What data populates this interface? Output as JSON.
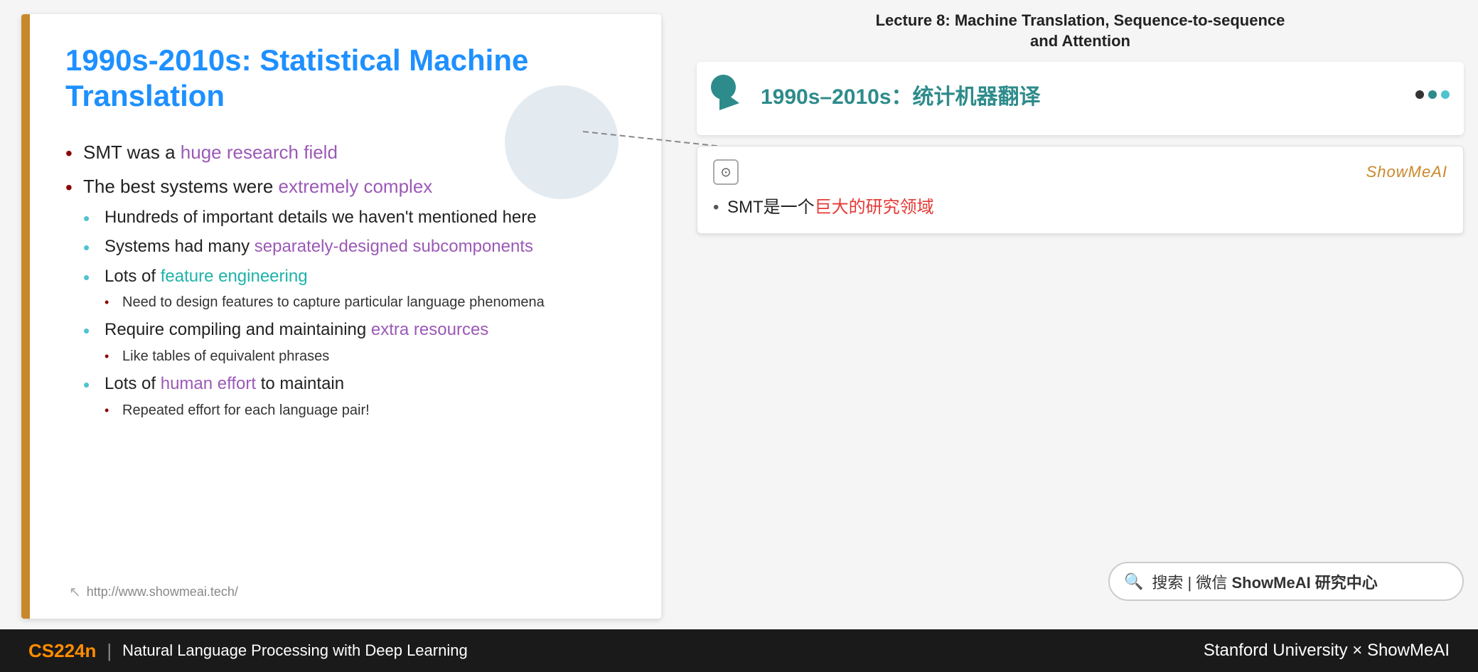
{
  "slide": {
    "title": "1990s-2010s: Statistical Machine Translation",
    "bullets": [
      {
        "text_before": "SMT was a ",
        "highlight": "huge research field",
        "highlight_class": "highlight-purple",
        "text_after": ""
      },
      {
        "text_before": "The best systems were ",
        "highlight": "extremely complex",
        "highlight_class": "highlight-purple",
        "text_after": "",
        "sub_bullets": [
          {
            "text": "Hundreds of important details we haven't mentioned here",
            "sub_sub": []
          },
          {
            "text_before": "Systems had many ",
            "highlight": "separately-designed subcomponents",
            "highlight_class": "highlight-purple",
            "text_after": "",
            "sub_sub": []
          },
          {
            "text_before": "Lots of ",
            "highlight": "feature engineering",
            "highlight_class": "highlight-teal",
            "text_after": "",
            "sub_sub": [
              "Need to design features to capture particular language phenomena"
            ]
          },
          {
            "text_before": "Require compiling and maintaining ",
            "highlight": "extra resources",
            "highlight_class": "highlight-purple",
            "text_after": "",
            "sub_sub": [
              "Like tables of equivalent phrases"
            ]
          },
          {
            "text_before": "Lots of ",
            "highlight": "human effort",
            "highlight_class": "highlight-purple",
            "text_after": " to maintain",
            "sub_sub": [
              "Repeated effort for each language pair!"
            ]
          }
        ]
      }
    ],
    "url": "http://www.showmeai.tech/"
  },
  "lecture": {
    "title": "Lecture 8:  Machine Translation, Sequence-to-sequence\nand Attention"
  },
  "chinese_slide": {
    "title": "1990s–2010s：统计机器翻译"
  },
  "ai_card": {
    "brand": "ShowMeAI",
    "bullet": "SMT是一个",
    "highlight": "巨大的研究领域",
    "highlight_class": "highlight-red"
  },
  "search": {
    "label": "🔍 搜索 | 微信 ShowMeAI 研究中心"
  },
  "bottom_bar": {
    "course": "CS224n",
    "divider": "|",
    "description": "Natural Language Processing with Deep Learning",
    "right": "Stanford University  ×  ShowMeAI"
  }
}
